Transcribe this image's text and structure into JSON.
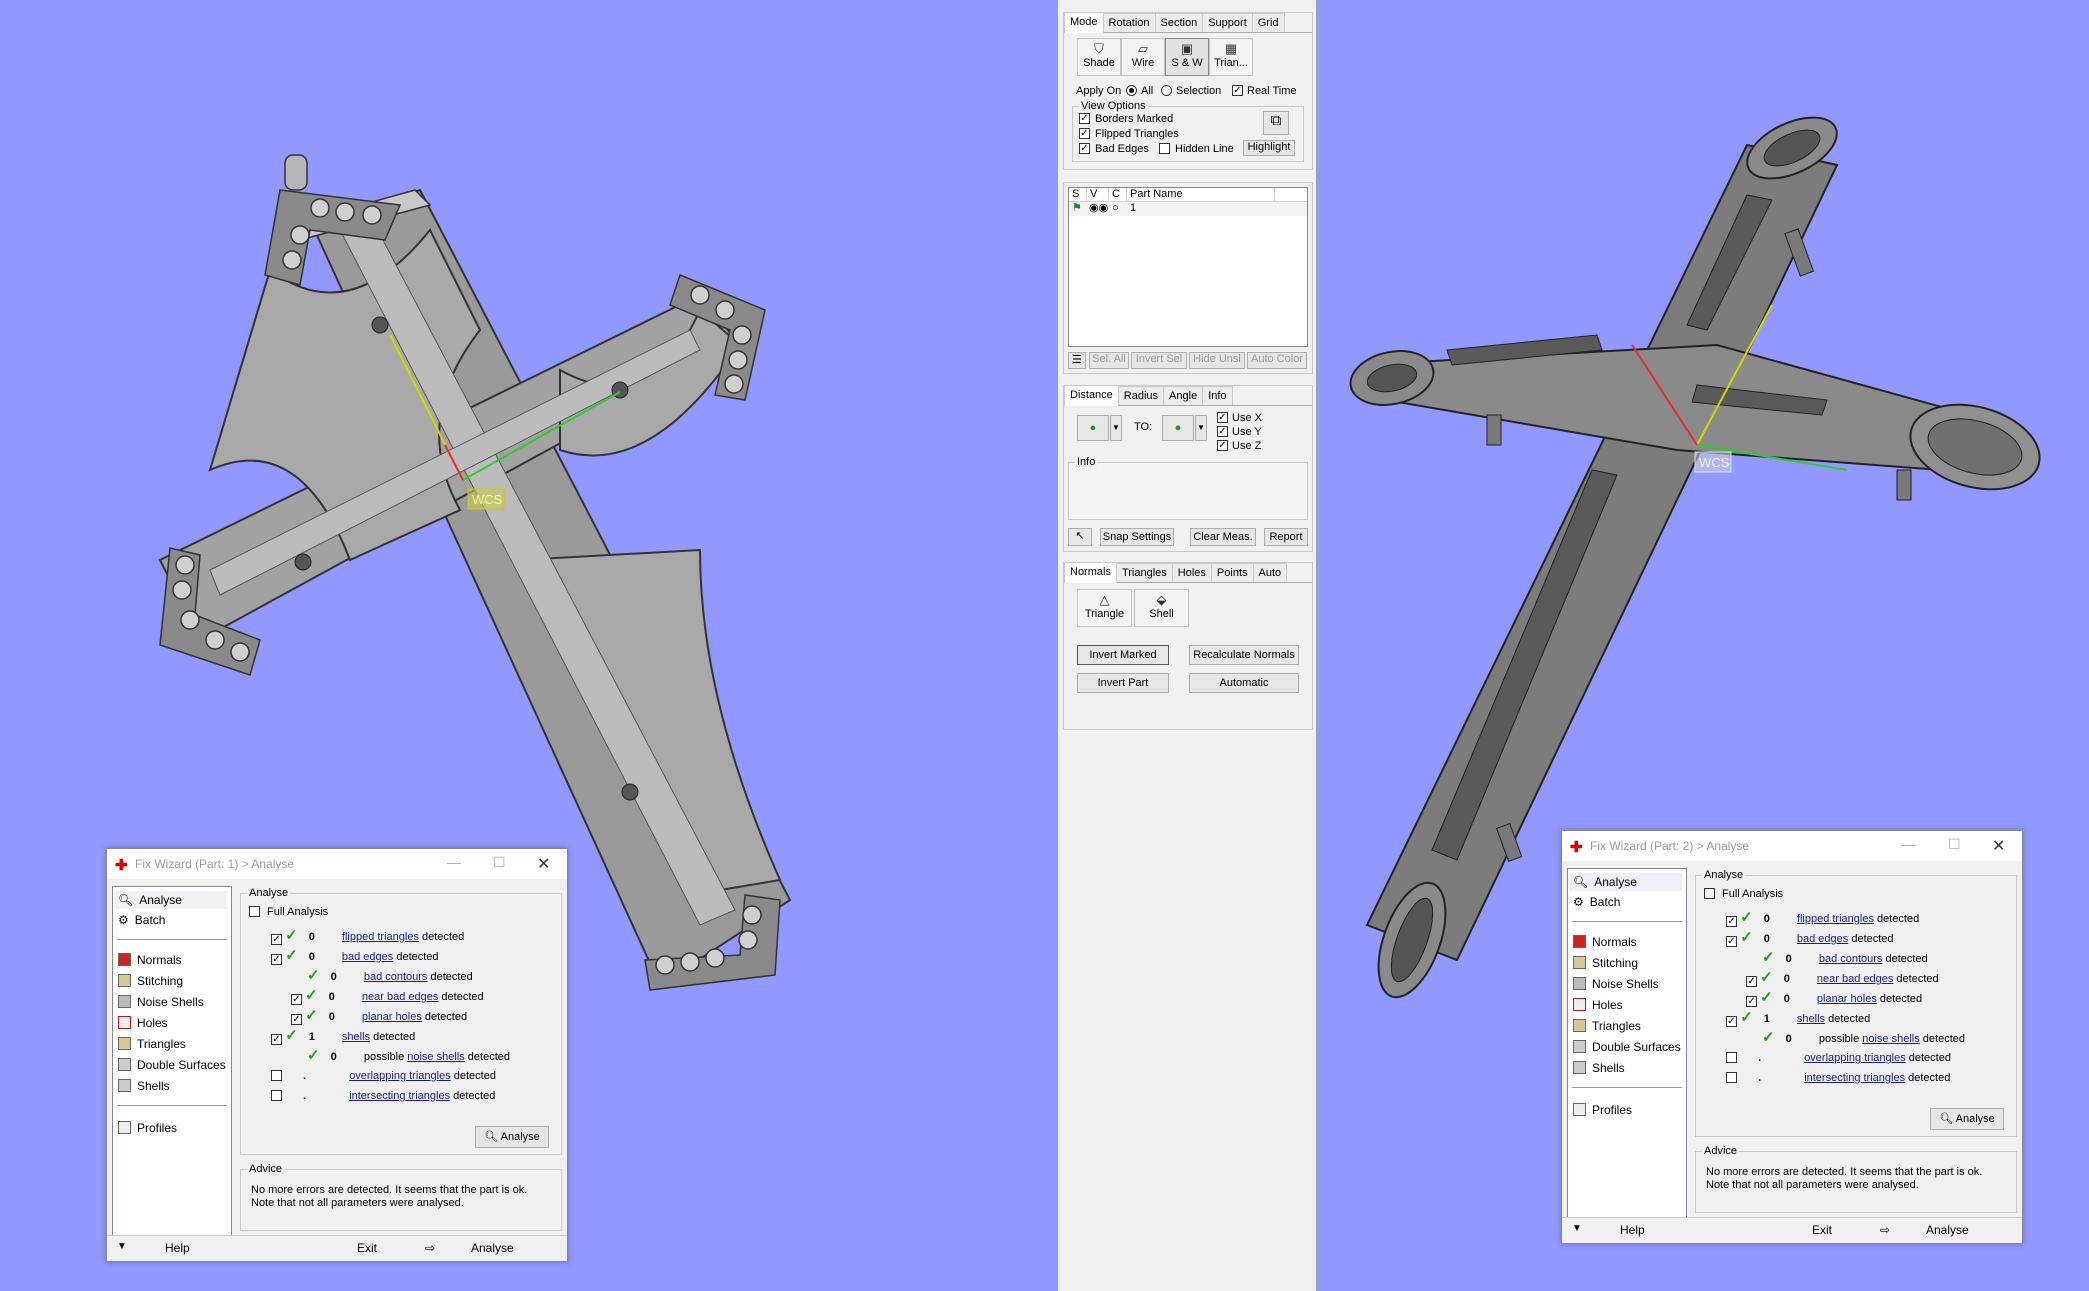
{
  "viewport_left": {
    "wcs_label": "WCS"
  },
  "viewport_right": {
    "wcs_label": "WCS"
  },
  "panel_view": {
    "tabs": [
      "Mode",
      "Rotation",
      "Section",
      "Support",
      "Grid"
    ],
    "buttons": [
      "Shade",
      "Wire",
      "S & W",
      "Trian..."
    ],
    "apply_on_label": "Apply On",
    "all_label": "All",
    "selection_label": "Selection",
    "real_time_label": "Real Time",
    "view_options_title": "View Options",
    "borders_marked": "Borders Marked",
    "flipped_triangles": "Flipped Triangles",
    "bad_edges": "Bad Edges",
    "hidden_line": "Hidden Line",
    "highlight": "Highlight"
  },
  "panel_parts": {
    "columns": [
      "S",
      "V",
      "C",
      "Part Name"
    ],
    "rows": [
      {
        "name": "1"
      }
    ],
    "buttons": [
      "Sel. All",
      "Invert Sel",
      "Hide Unsl",
      "Auto Color"
    ]
  },
  "panel_measure": {
    "tabs": [
      "Distance",
      "Radius",
      "Angle",
      "Info"
    ],
    "to_label": "TO:",
    "use_x": "Use X",
    "use_y": "Use Y",
    "use_z": "Use Z",
    "info_title": "Info",
    "buttons": [
      "Snap Settings",
      "Clear Meas.",
      "Report"
    ]
  },
  "panel_normals": {
    "tabs": [
      "Normals",
      "Triangles",
      "Holes",
      "Points",
      "Auto"
    ],
    "tool_buttons": [
      "Triangle",
      "Shell"
    ],
    "buttons": [
      "Invert Marked",
      "Recalculate Normals",
      "Invert Part",
      "Automatic"
    ]
  },
  "fix_wizard_1": {
    "title": "Fix Wizard (Part: 1) > Analyse",
    "side_top": [
      "Analyse",
      "Batch"
    ],
    "side_mid": [
      "Normals",
      "Stitching",
      "Noise Shells",
      "Holes",
      "Triangles",
      "Double Surfaces",
      "Shells"
    ],
    "side_bottom": [
      "Profiles"
    ],
    "group_analyse": "Analyse",
    "full_analysis": "Full Analysis",
    "rows": [
      {
        "value": "0",
        "link": "flipped triangles",
        "pre": "",
        "suffix": "detected"
      },
      {
        "value": "0",
        "link": "bad edges",
        "pre": "",
        "suffix": "detected"
      },
      {
        "value": "0",
        "link": "bad contours",
        "pre": "",
        "suffix": "detected"
      },
      {
        "value": "0",
        "link": "near bad edges",
        "pre": "",
        "suffix": "detected"
      },
      {
        "value": "0",
        "link": "planar holes",
        "pre": "",
        "suffix": "detected"
      },
      {
        "value": "1",
        "link": "shells",
        "pre": "",
        "suffix": "detected"
      },
      {
        "value": "0",
        "link": "noise shells",
        "pre": "possible ",
        "suffix": "detected"
      },
      {
        "value": ".",
        "link": "overlapping triangles",
        "pre": "",
        "suffix": "detected"
      },
      {
        "value": ".",
        "link": "intersecting triangles",
        "pre": "",
        "suffix": "detected"
      }
    ],
    "analyse_button": "Analyse",
    "advice_title": "Advice",
    "advice_text": "No more errors are detected. It seems that the part is ok. Note that not all parameters were analysed.",
    "footer": {
      "help": "Help",
      "exit": "Exit",
      "analyse": "Analyse"
    }
  },
  "fix_wizard_2": {
    "title": "Fix Wizard (Part: 2) > Analyse",
    "side_top": [
      "Analyse",
      "Batch"
    ],
    "side_mid": [
      "Normals",
      "Stitching",
      "Noise Shells",
      "Holes",
      "Triangles",
      "Double Surfaces",
      "Shells"
    ],
    "side_bottom": [
      "Profiles"
    ],
    "group_analyse": "Analyse",
    "full_analysis": "Full Analysis",
    "rows": [
      {
        "value": "0",
        "link": "flipped triangles",
        "pre": "",
        "suffix": "detected"
      },
      {
        "value": "0",
        "link": "bad edges",
        "pre": "",
        "suffix": "detected"
      },
      {
        "value": "0",
        "link": "bad contours",
        "pre": "",
        "suffix": "detected"
      },
      {
        "value": "0",
        "link": "near bad edges",
        "pre": "",
        "suffix": "detected"
      },
      {
        "value": "0",
        "link": "planar holes",
        "pre": "",
        "suffix": "detected"
      },
      {
        "value": "1",
        "link": "shells",
        "pre": "",
        "suffix": "detected"
      },
      {
        "value": "0",
        "link": "noise shells",
        "pre": "possible ",
        "suffix": "detected"
      },
      {
        "value": ".",
        "link": "overlapping triangles",
        "pre": "",
        "suffix": "detected"
      },
      {
        "value": ".",
        "link": "intersecting triangles",
        "pre": "",
        "suffix": "detected"
      }
    ],
    "analyse_button": "Analyse",
    "advice_title": "Advice",
    "advice_text": "No more errors are detected. It seems that the part is ok. Note that not all parameters were analysed.",
    "footer": {
      "help": "Help",
      "exit": "Exit",
      "analyse": "Analyse"
    }
  },
  "colors": {
    "viewport_bg": "#9198ff",
    "model_light": "#a9a9a9",
    "model_dark": "#6b6b6b",
    "check_green": "#1e9e1e"
  }
}
